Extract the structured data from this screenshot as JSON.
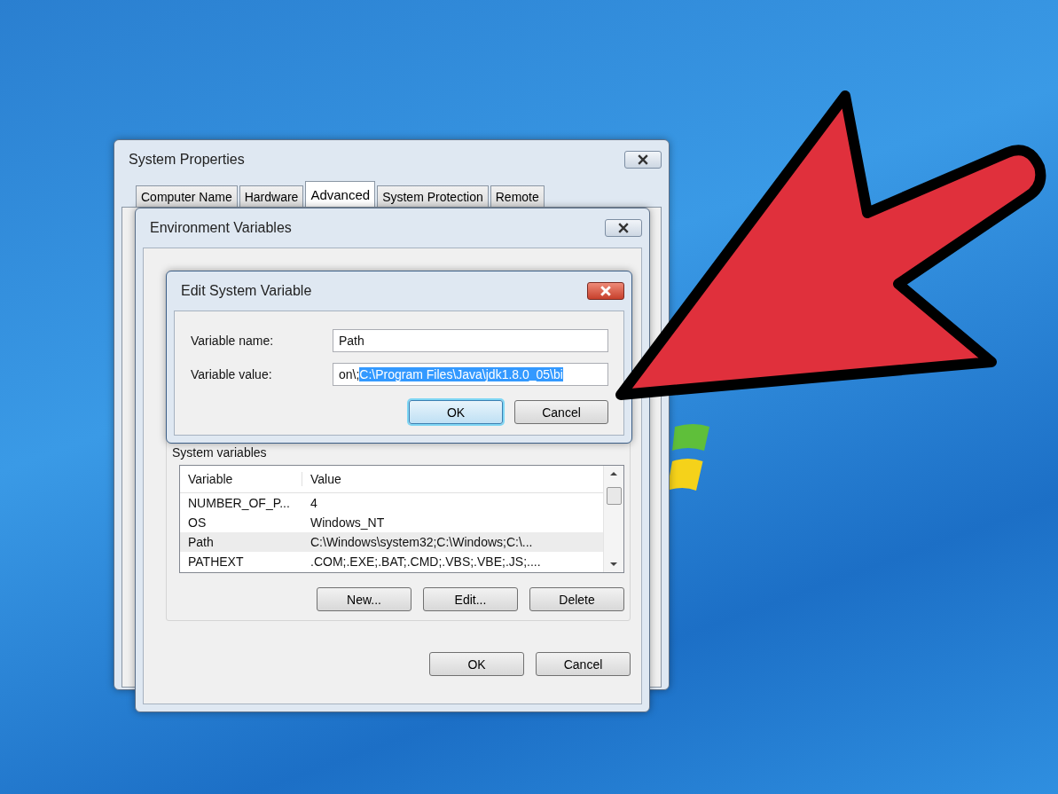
{
  "system_properties": {
    "title": "System Properties",
    "tabs": [
      {
        "label": "Computer Name",
        "selected": false
      },
      {
        "label": "Hardware",
        "selected": false
      },
      {
        "label": "Advanced",
        "selected": true
      },
      {
        "label": "System Protection",
        "selected": false
      },
      {
        "label": "Remote",
        "selected": false
      }
    ]
  },
  "environment_variables": {
    "title": "Environment Variables",
    "system_variables": {
      "label": "System variables",
      "columns": [
        "Variable",
        "Value"
      ],
      "rows": [
        {
          "variable": "NUMBER_OF_P...",
          "value": "4",
          "selected": false
        },
        {
          "variable": "OS",
          "value": "Windows_NT",
          "selected": false
        },
        {
          "variable": "Path",
          "value": "C:\\Windows\\system32;C:\\Windows;C:\\...",
          "selected": true
        },
        {
          "variable": "PATHEXT",
          "value": ".COM;.EXE;.BAT;.CMD;.VBS;.VBE;.JS;....",
          "selected": false
        }
      ],
      "buttons": [
        "New...",
        "Edit...",
        "Delete"
      ]
    },
    "buttons": [
      {
        "label": "OK",
        "default": false
      },
      {
        "label": "Cancel",
        "default": false
      }
    ]
  },
  "edit_dialog": {
    "title": "Edit System Variable",
    "fields": [
      {
        "label": "Variable name:",
        "value": "Path"
      },
      {
        "label": "Variable value:",
        "value": "on\\;",
        "selected_text": "C:\\Program Files\\Java\\jdk1.8.0_05\\bi"
      }
    ],
    "buttons": [
      {
        "label": "OK",
        "default": true
      },
      {
        "label": "Cancel",
        "default": false
      }
    ]
  }
}
